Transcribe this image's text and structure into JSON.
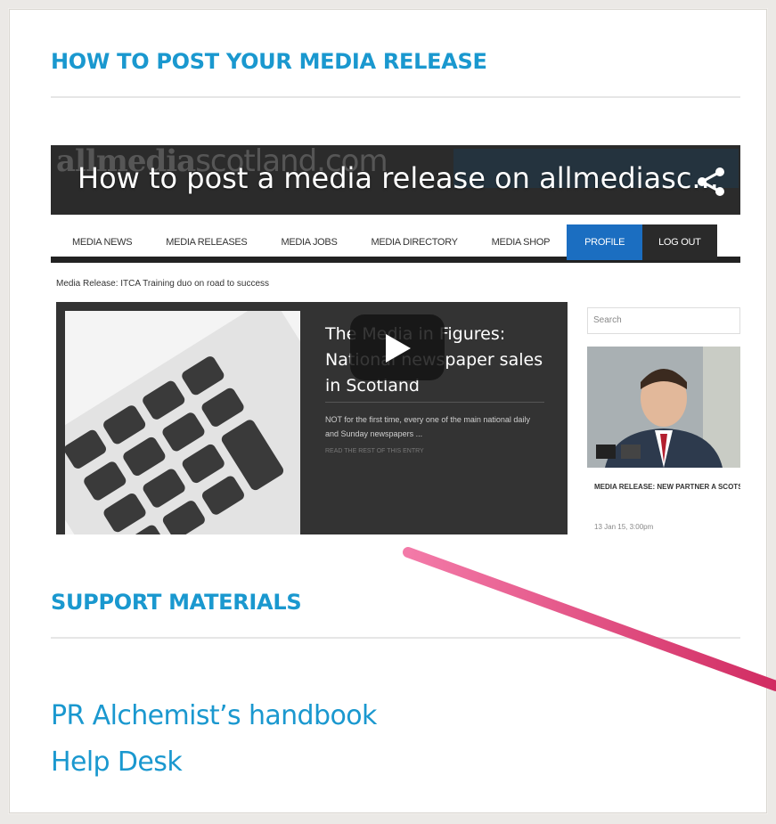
{
  "sections": {
    "how_to_post": {
      "title": "HOW TO POST YOUR MEDIA RELEASE"
    },
    "support": {
      "title": "SUPPORT MATERIALS"
    }
  },
  "video": {
    "title": "How to post a media release on allmediasc...",
    "brand_bold": "allmedia",
    "brand_light": "scotland.com",
    "site_nav": [
      "MEDIA NEWS",
      "MEDIA RELEASES",
      "MEDIA JOBS",
      "MEDIA DIRECTORY",
      "MEDIA SHOP",
      "PROFILE",
      "LOG OUT"
    ],
    "breadcrumb": "Media Release: ITCA Training duo on road to success",
    "feature": {
      "heading": "The Media in Figures: National newspaper sales in Scotland",
      "excerpt": "NOT for the first time, every one of the main national daily and Sunday newspapers ...",
      "read_more": "READ THE REST OF THIS ENTRY"
    },
    "sidebar": {
      "search_placeholder": "Search",
      "caption": "MEDIA RELEASE: NEW PARTNER A SCOTS START-UPS ACCESS HIGH-L ENTREPRENEURIAL TAX ADVICE",
      "date": "13 Jan 15, 3:00pm"
    }
  },
  "links": [
    {
      "label": "PR Alchemist’s handbook"
    },
    {
      "label": "Help Desk"
    }
  ],
  "colors": {
    "accent": "#1a98cf",
    "arrow": "#e0407a"
  }
}
